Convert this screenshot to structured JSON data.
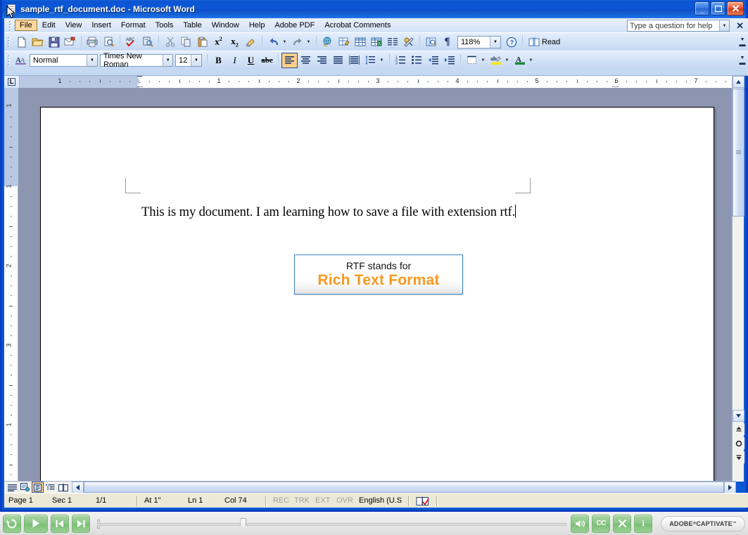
{
  "window": {
    "title": "sample_rtf_document.doc - Microsoft Word",
    "icon": "word-document-icon",
    "minimize_label": "–",
    "maximize_label": "□",
    "close_label": "✕"
  },
  "menubar": {
    "items": [
      {
        "label": "File",
        "active": true
      },
      {
        "label": "Edit",
        "active": false
      },
      {
        "label": "View",
        "active": false
      },
      {
        "label": "Insert",
        "active": false
      },
      {
        "label": "Format",
        "active": false
      },
      {
        "label": "Tools",
        "active": false
      },
      {
        "label": "Table",
        "active": false
      },
      {
        "label": "Window",
        "active": false
      },
      {
        "label": "Help",
        "active": false
      },
      {
        "label": "Adobe PDF",
        "active": false
      },
      {
        "label": "Acrobat Comments",
        "active": false
      }
    ],
    "ask_placeholder": "Type a question for help",
    "close_label": "✕"
  },
  "standard_toolbar": {
    "buttons": [
      "new-document-icon",
      "open-folder-icon",
      "save-disk-icon",
      "email-icon",
      "print-icon",
      "print-preview-icon",
      "spelling-check-icon",
      "research-icon",
      "cut-scissors-icon",
      "copy-icon",
      "paste-clipboard-icon",
      "superscript-icon",
      "subscript-icon",
      "format-painter-icon",
      "undo-icon",
      "redo-icon",
      "insert-hyperlink-icon",
      "tables-and-borders-icon",
      "insert-table-icon",
      "insert-excel-sheet-icon",
      "columns-icon",
      "drawing-icon",
      "document-map-icon",
      "show-formatting-marks-icon"
    ],
    "zoom_value": "118%",
    "read_label": "Read",
    "read_icon": "read-book-icon",
    "help_icon": "help-question-icon"
  },
  "formatting_toolbar": {
    "styles_icon": "styles-and-formatting-icon",
    "style_value": "Normal",
    "font_value": "Times New Roman",
    "size_value": "12",
    "bold_label": "B",
    "italic_label": "I",
    "underline_label": "U",
    "strikethrough_label": "abc",
    "align_left": "align-left-icon",
    "align_center": "align-center-icon",
    "align_right": "align-right-icon",
    "align_justify": "align-justify-icon",
    "align_distributed": "align-distributed-icon",
    "line_spacing": "line-spacing-icon",
    "numbering": "numbered-list-icon",
    "bullets": "bulleted-list-icon",
    "decrease_indent": "decrease-indent-icon",
    "increase_indent": "increase-indent-icon",
    "borders": "outside-border-icon",
    "highlight": "highlight-color-icon",
    "font_color": "font-color-icon",
    "active_alignment": "align-left"
  },
  "ruler": {
    "tab_stop_label": "L",
    "horizontal_numbers": [
      "1",
      "1",
      "2",
      "3",
      "4",
      "5",
      "7"
    ],
    "vertical_numbers": [
      "1",
      "1",
      "2",
      "3"
    ]
  },
  "document": {
    "body_text": "This is my document. I am learning how to save a file with extension rtf.",
    "callout": {
      "line1": "RTF stands for",
      "line2": "Rich Text Format",
      "border_color": "#3d85c6",
      "accent_color": "#f79a20"
    }
  },
  "view_buttons": [
    {
      "name": "normal-view",
      "icon": "normal-view-icon",
      "selected": false
    },
    {
      "name": "web-layout-view",
      "icon": "web-layout-icon",
      "selected": false
    },
    {
      "name": "print-layout-view",
      "icon": "print-layout-icon",
      "selected": true
    },
    {
      "name": "outline-view",
      "icon": "outline-view-icon",
      "selected": false
    },
    {
      "name": "reading-layout-view",
      "icon": "reading-layout-icon",
      "selected": false
    }
  ],
  "statusbar": {
    "page": "Page 1",
    "section": "Sec 1",
    "pages": "1/1",
    "at": "At 1\"",
    "line": "Ln 1",
    "column": "Col 74",
    "rec": "REC",
    "trk": "TRK",
    "ext": "EXT",
    "ovr": "OVR",
    "language": "English (U.S",
    "spell_icon": "spelling-status-icon"
  },
  "playbar": {
    "rewind": "rewind-icon",
    "play": "play-icon",
    "previous": "previous-slide-icon",
    "next": "next-slide-icon",
    "volume": "volume-icon",
    "cc_label": "CC",
    "close_label": "✕",
    "info_label": "i",
    "brand": "ADOBE CAPTIVATE",
    "brand_word1": "ADOBE",
    "brand_word2": "CAPTIVATE",
    "reg_mark": "®",
    "tm_mark": "™",
    "progress_percent": 2
  }
}
